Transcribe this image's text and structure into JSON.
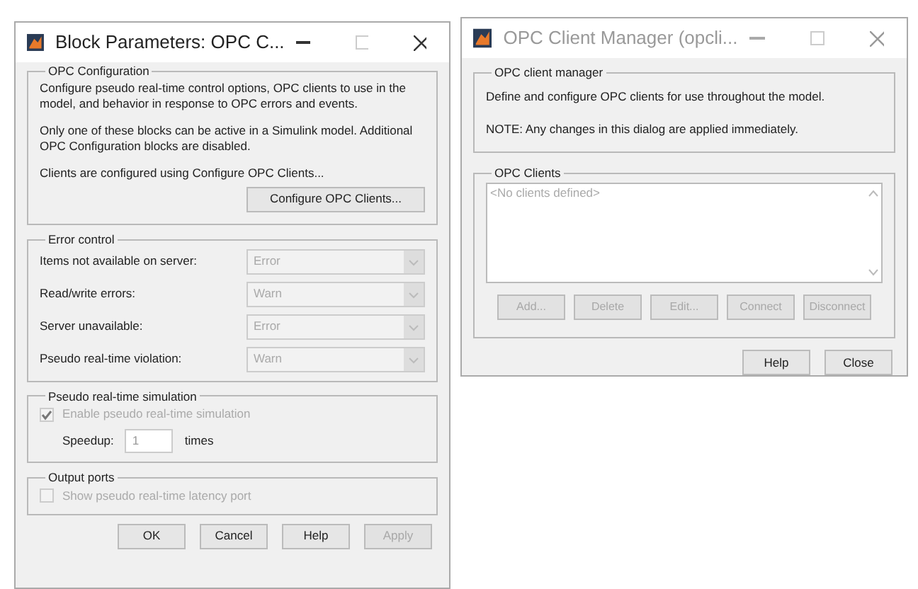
{
  "windows": [
    {
      "title": "Block Parameters: OPC C...",
      "active": true,
      "opc_configuration": {
        "legend": "OPC Configuration",
        "paragraphs": [
          "Configure pseudo real-time control options, OPC clients to use in the model, and behavior in response to OPC errors and events.",
          "Only one of these blocks can be active in a Simulink model. Additional OPC Configuration blocks are disabled.",
          "Clients are configured using Configure OPC Clients..."
        ],
        "button": "Configure OPC Clients..."
      },
      "error_control": {
        "legend": "Error control",
        "rows": [
          {
            "label": "Items not available on server:",
            "value": "Error",
            "disabled": true
          },
          {
            "label": "Read/write errors:",
            "value": "Warn",
            "disabled": true
          },
          {
            "label": "Server unavailable:",
            "value": "Error",
            "disabled": true
          },
          {
            "label": "Pseudo real-time violation:",
            "value": "Warn",
            "disabled": true
          }
        ]
      },
      "pseudo_real_time": {
        "legend": "Pseudo real-time simulation",
        "checkbox": {
          "label": "Enable pseudo real-time simulation",
          "checked": true,
          "disabled": true
        },
        "speedup_label": "Speedup:",
        "speedup_value": "1",
        "speedup_unit": "times"
      },
      "output_ports": {
        "legend": "Output ports",
        "checkbox": {
          "label": "Show pseudo real-time latency port",
          "checked": false,
          "disabled": true
        }
      },
      "buttons": [
        {
          "label": "OK",
          "disabled": false
        },
        {
          "label": "Cancel",
          "disabled": false
        },
        {
          "label": "Help",
          "disabled": false
        },
        {
          "label": "Apply",
          "disabled": true
        }
      ]
    },
    {
      "title": "OPC Client Manager (opcli...",
      "active": false,
      "manager": {
        "legend": "OPC client manager",
        "paragraphs": [
          "Define and configure OPC clients for use throughout the model.",
          "NOTE: Any changes in this dialog are applied immediately."
        ]
      },
      "clients": {
        "legend": "OPC Clients",
        "placeholder": "<No clients defined>",
        "buttons": [
          {
            "label": "Add...",
            "disabled": true
          },
          {
            "label": "Delete",
            "disabled": true
          },
          {
            "label": "Edit...",
            "disabled": true
          },
          {
            "label": "Connect",
            "disabled": true
          },
          {
            "label": "Disconnect",
            "disabled": true
          }
        ]
      },
      "buttons": [
        {
          "label": "Help",
          "disabled": false
        },
        {
          "label": "Close",
          "disabled": false
        }
      ]
    }
  ]
}
